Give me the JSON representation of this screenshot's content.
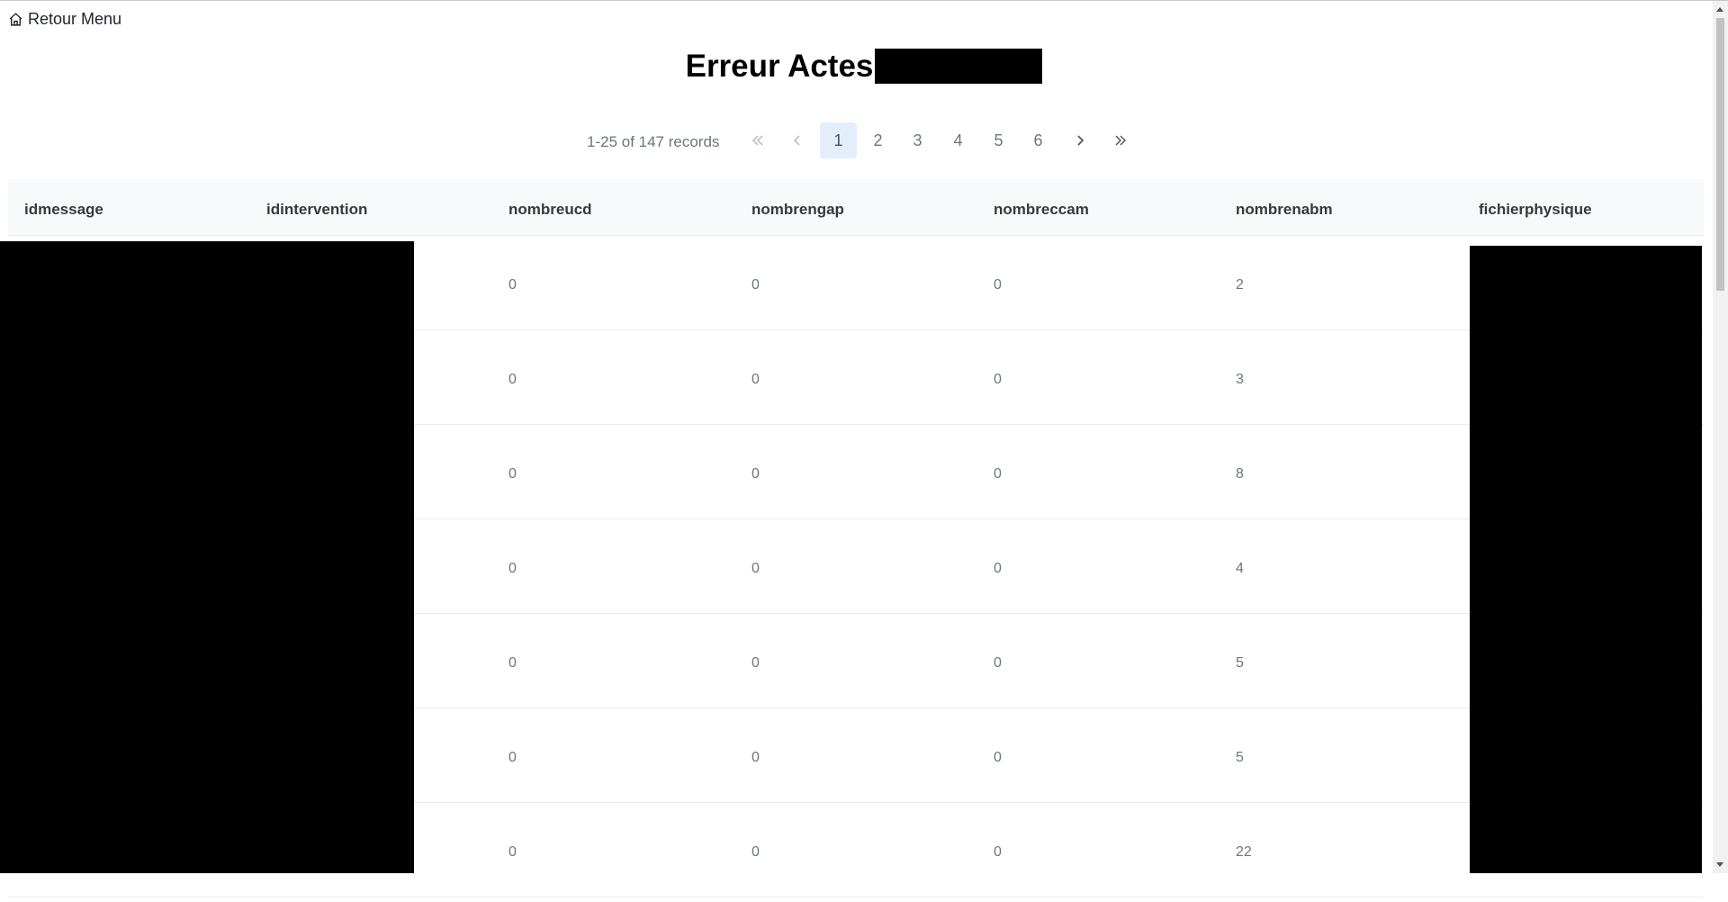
{
  "nav": {
    "home_label": "Retour Menu",
    "home_icon": "home-icon"
  },
  "page": {
    "title": "Erreur Actes"
  },
  "pagination": {
    "records_text": "1-25 of 147 records",
    "first_icon": "double-chevron-left-icon",
    "prev_icon": "chevron-left-icon",
    "next_icon": "chevron-right-icon",
    "last_icon": "double-chevron-right-icon",
    "pages": [
      "1",
      "2",
      "3",
      "4",
      "5",
      "6"
    ],
    "current_page": "1"
  },
  "table": {
    "columns": [
      "idmessage",
      "idintervention",
      "nombreucd",
      "nombrengap",
      "nombreccam",
      "nombrenabm",
      "fichierphysique"
    ],
    "rows": [
      {
        "nombreucd": "0",
        "nombrengap": "0",
        "nombreccam": "0",
        "nombrenabm": "2"
      },
      {
        "nombreucd": "0",
        "nombrengap": "0",
        "nombreccam": "0",
        "nombrenabm": "3"
      },
      {
        "nombreucd": "0",
        "nombrengap": "0",
        "nombreccam": "0",
        "nombrenabm": "8"
      },
      {
        "nombreucd": "0",
        "nombrengap": "0",
        "nombreccam": "0",
        "nombrenabm": "4"
      },
      {
        "nombreucd": "0",
        "nombrengap": "0",
        "nombreccam": "0",
        "nombrenabm": "5"
      },
      {
        "nombreucd": "0",
        "nombrengap": "0",
        "nombreccam": "0",
        "nombrenabm": "5"
      },
      {
        "nombreucd": "0",
        "nombrengap": "0",
        "nombreccam": "0",
        "nombrenabm": "22"
      }
    ]
  },
  "colors": {
    "active_page_bg": "#e3eefb",
    "header_bg": "#f8f9fa",
    "redaction": "#000000"
  }
}
